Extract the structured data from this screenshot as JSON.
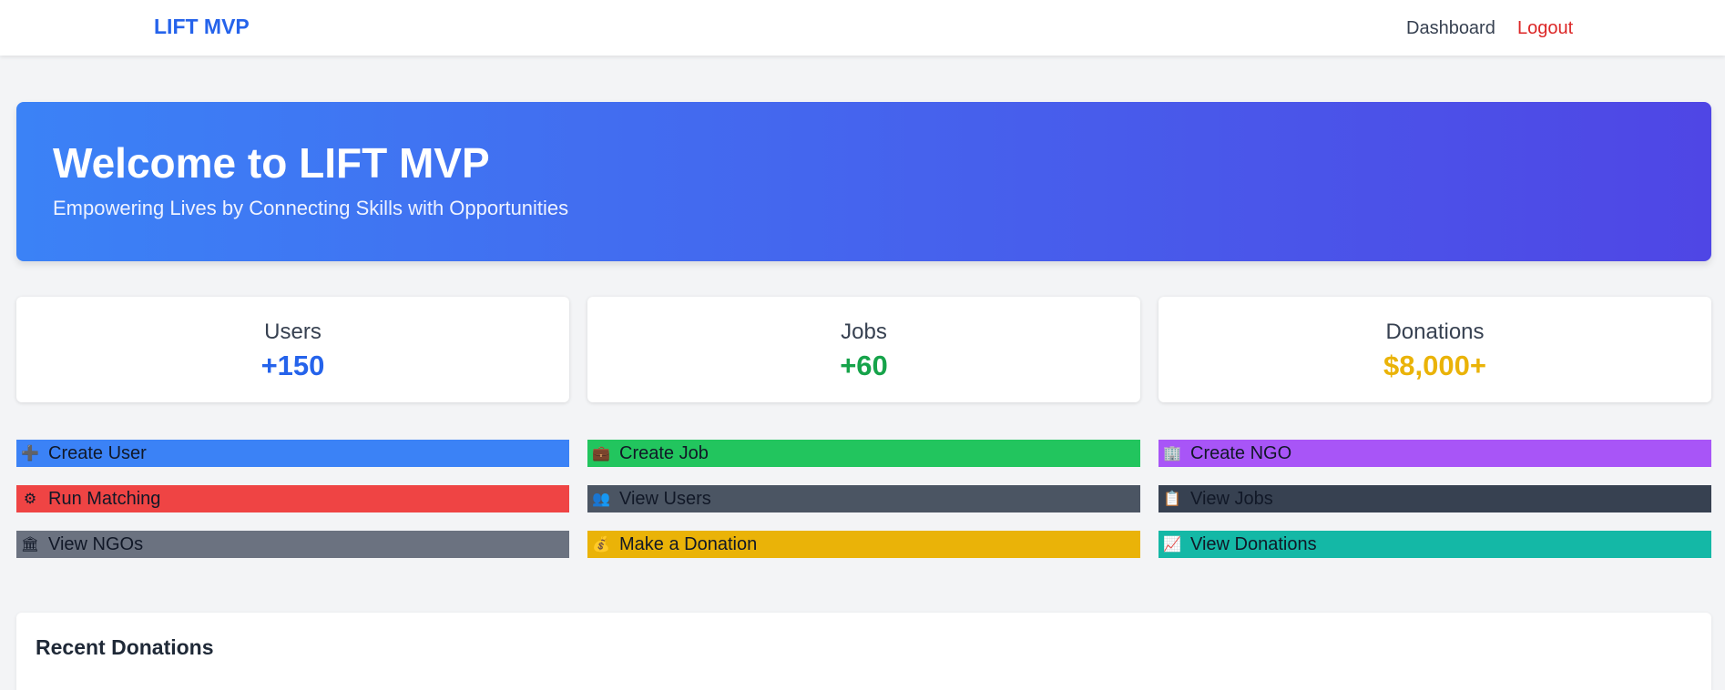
{
  "navbar": {
    "brand": "LIFT MVP",
    "links": [
      "Dashboard",
      "Logout"
    ]
  },
  "hero": {
    "title": "Welcome to LIFT MVP",
    "subtitle": "Empowering Lives by Connecting Skills with Opportunities"
  },
  "stats": [
    {
      "label": "Users",
      "value": "+150",
      "color": "#2563eb"
    },
    {
      "label": "Jobs",
      "value": "+60",
      "color": "#16a34a"
    },
    {
      "label": "Donations",
      "value": "$8,000+",
      "color": "#eab308"
    }
  ],
  "actions": [
    {
      "label": "Create User",
      "icon": "plus-icon",
      "glyph": "➕",
      "color": "#3b82f6"
    },
    {
      "label": "Create Job",
      "icon": "briefcase-icon",
      "glyph": "💼",
      "color": "#22c55e"
    },
    {
      "label": "Create NGO",
      "icon": "building-icon",
      "glyph": "🏢",
      "color": "#a855f7"
    },
    {
      "label": "Run Matching",
      "icon": "gear-icon",
      "glyph": "⚙",
      "color": "#ef4444"
    },
    {
      "label": "View Users",
      "icon": "users-icon",
      "glyph": "👥",
      "color": "#4b5563"
    },
    {
      "label": "View Jobs",
      "icon": "clipboard-icon",
      "glyph": "📋",
      "color": "#374151"
    },
    {
      "label": "View NGOs",
      "icon": "bank-icon",
      "glyph": "🏛",
      "color": "#6b7280"
    },
    {
      "label": "Make a Donation",
      "icon": "money-bag-icon",
      "glyph": "💰",
      "color": "#eab308"
    },
    {
      "label": "View Donations",
      "icon": "chart-icon",
      "glyph": "📈",
      "color": "#14b8a6"
    }
  ],
  "recent": {
    "title": "Recent Donations"
  }
}
